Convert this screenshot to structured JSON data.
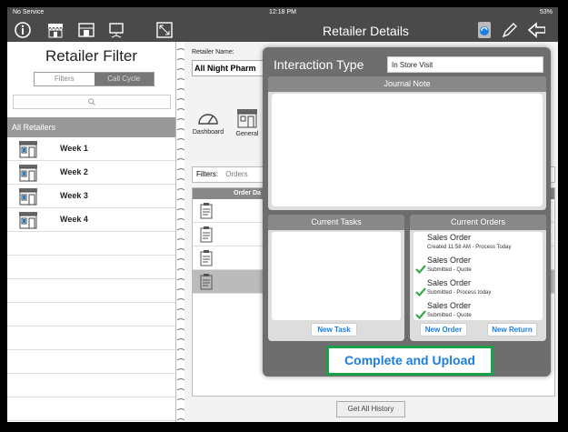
{
  "status_bar": {
    "carrier": "No Service",
    "time": "12:18 PM",
    "battery": "53%"
  },
  "nav": {
    "title": "Retailer Details"
  },
  "left_panel": {
    "title": "Retailer Filter",
    "segments": [
      {
        "label": "Filters"
      },
      {
        "label": "Call Cycle"
      }
    ],
    "search_placeholder": "",
    "section_header": "All Retailers",
    "weeks": [
      {
        "label": "Week 1"
      },
      {
        "label": "Week 2"
      },
      {
        "label": "Week 3"
      },
      {
        "label": "Week 4"
      }
    ]
  },
  "retailer": {
    "name_label": "Retailer Name:",
    "name_value": "All Night Pharm",
    "tiles": [
      {
        "label": "Dashboard"
      },
      {
        "label": "General"
      }
    ],
    "filters_label": "Filters:",
    "filters_value": "Orders",
    "order_header": "Order Da",
    "get_history": "Get All History"
  },
  "popup": {
    "title": "Interaction Type",
    "interaction_value": "In Store Visit",
    "journal_title": "Journal Note",
    "tasks_title": "Current Tasks",
    "new_task": "New Task",
    "orders_title": "Current Orders",
    "orders": [
      {
        "title": "Sales Order",
        "subtitle": "Created 11:58 AM - Process Today",
        "checked": false
      },
      {
        "title": "Sales Order",
        "subtitle": "Submitted - Quote",
        "checked": true
      },
      {
        "title": "Sales Order",
        "subtitle": "Submitted - Process today",
        "checked": true
      },
      {
        "title": "Sales Order",
        "subtitle": "Submitted - Quote",
        "checked": true
      }
    ],
    "new_order": "New Order",
    "new_return": "New Return",
    "complete_upload": "Complete and Upload"
  },
  "colors": {
    "accent_blue": "#1a7ee0",
    "highlight_green": "#1aa14c",
    "check_green": "#3aa845",
    "bar_gray": "#4a4a4a"
  }
}
